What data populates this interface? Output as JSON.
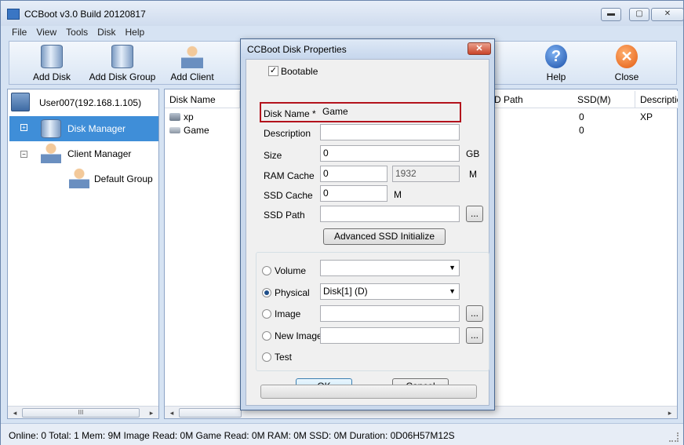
{
  "app": {
    "title": "CCBoot v3.0 Build 20120817",
    "window_controls": {
      "minimize": "▬",
      "maximize": "▢",
      "close": "✕"
    }
  },
  "menu": [
    "File",
    "View",
    "Tools",
    "Disk",
    "Help"
  ],
  "toolbar": {
    "add_disk": "Add Disk",
    "add_disk_group": "Add Disk Group",
    "add_client": "Add Client",
    "help": "Help",
    "close": "Close"
  },
  "tree": {
    "root": "User007(192.168.1.105)",
    "disk_manager": "Disk Manager",
    "client_manager": "Client Manager",
    "default_group": "Default Group",
    "expand_plus": "+",
    "expand_minus": "−"
  },
  "table": {
    "columns": {
      "disk_name": "Disk Name",
      "ssd_path": "D Path",
      "ssd": "SSD(M)",
      "description": "Descriptio"
    },
    "rows": [
      {
        "name": "xp",
        "ssd": "0",
        "description": "XP"
      },
      {
        "name": "Game",
        "ssd": "0",
        "description": ""
      }
    ]
  },
  "scroll": {
    "left": "◂",
    "right": "▸",
    "grip": "III"
  },
  "status": "Online: 0 Total: 1 Mem: 9M Image Read: 0M Game Read: 0M RAM: 0M SSD: 0M Duration: 0D06H57M12S",
  "dialog": {
    "title": "CCBoot Disk Properties",
    "close_glyph": "✕",
    "bootable_label": "Bootable",
    "bootable_checked": "✓",
    "disk_name_label": "Disk Name *",
    "disk_name_value": "Game",
    "description_label": "Description",
    "description_value": "",
    "size_label": "Size",
    "size_value": "0",
    "size_unit": "GB",
    "ram_cache_label": "RAM Cache",
    "ram_cache_value": "0",
    "ram_cache_max": "1932",
    "ram_cache_unit": "M",
    "ssd_cache_label": "SSD Cache",
    "ssd_cache_value": "0",
    "ssd_cache_unit": "M",
    "ssd_path_label": "SSD Path",
    "ssd_path_value": "",
    "browse": "...",
    "advanced_ssd_button": "Advanced SSD Initialize",
    "volume_label": "Volume",
    "volume_value": "",
    "physical_label": "Physical",
    "physical_value": "Disk[1] (D)",
    "image_label": "Image",
    "new_image_label": "New Image",
    "test_label": "Test",
    "ok": "OK",
    "cancel": "Cancel",
    "dropdown_glyph": "▼",
    "selected_source": "Physical"
  }
}
